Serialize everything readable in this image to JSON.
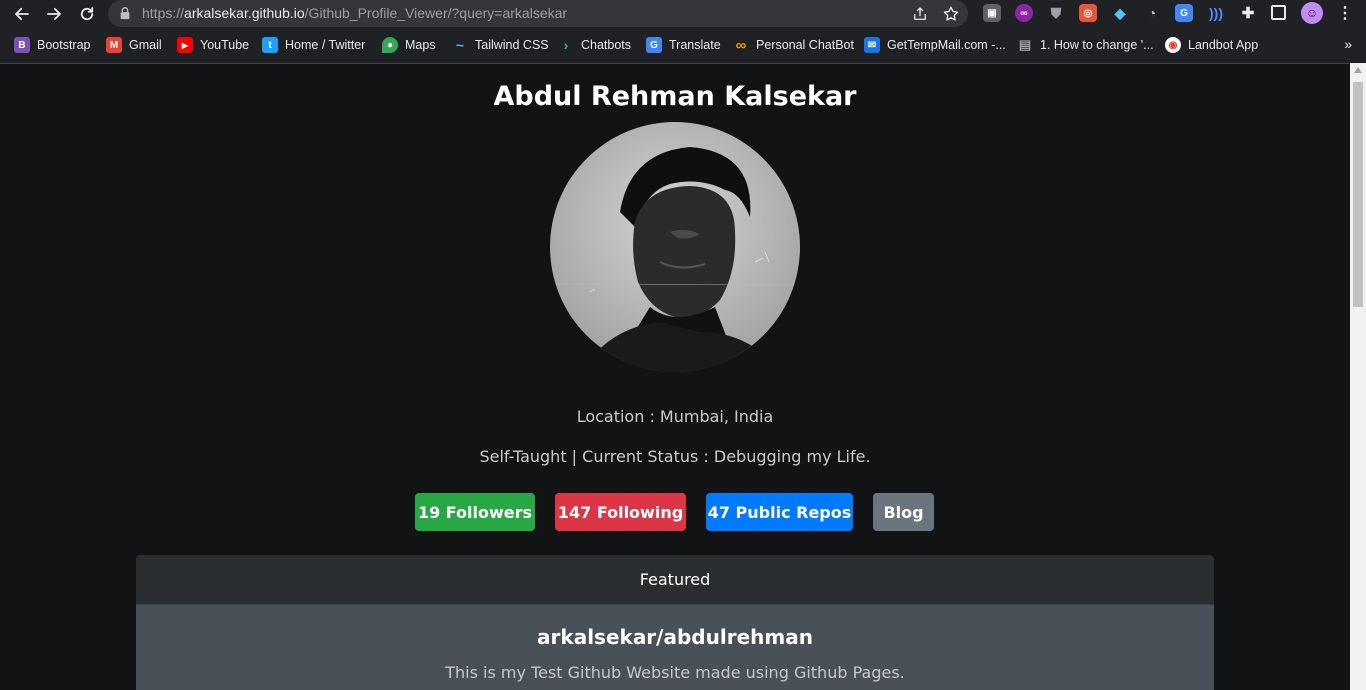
{
  "browser": {
    "url_scheme": "https://",
    "url_host": "arkalsekar.github.io",
    "url_path": "/Github_Profile_Viewer/?query=arkalsekar"
  },
  "bookmarks": [
    {
      "label": "Bootstrap",
      "icon": "bootstrap-icon",
      "color": "#7952b3",
      "glyph": "B"
    },
    {
      "label": "Gmail",
      "icon": "gmail-icon",
      "color": "#ea4335",
      "glyph": "M"
    },
    {
      "label": "YouTube",
      "icon": "youtube-icon",
      "color": "#ff0000",
      "glyph": "▶"
    },
    {
      "label": "Home / Twitter",
      "icon": "twitter-icon",
      "color": "#1da1f2",
      "glyph": "t"
    },
    {
      "label": "Maps",
      "icon": "maps-icon",
      "color": "#34a853",
      "glyph": "●"
    },
    {
      "label": "Tailwind CSS",
      "icon": "tailwind-icon",
      "color": "#38bdf8",
      "glyph": "~"
    },
    {
      "label": "Chatbots",
      "icon": "chatbots-icon",
      "color": "#1abc9c",
      "glyph": "›"
    },
    {
      "label": "Translate",
      "icon": "translate-icon",
      "color": "#4285f4",
      "glyph": "G"
    },
    {
      "label": "Personal ChatBot",
      "icon": "infinity-icon",
      "color": "#f29900",
      "glyph": "∞"
    },
    {
      "label": "GetTempMail.com -...",
      "icon": "mail-icon",
      "color": "#1a73e8",
      "glyph": "✉"
    },
    {
      "label": "1. How to change '...",
      "icon": "document-icon",
      "color": "#9aa0a6",
      "glyph": "▤"
    },
    {
      "label": "Landbot App",
      "icon": "landbot-icon",
      "color": "#ffffff",
      "glyph": "◉"
    }
  ],
  "bookmarks_more": "»",
  "profile": {
    "name": "Abdul Rehman Kalsekar",
    "location": "Location : Mumbai, India",
    "bio": "Self-Taught | Current Status : Debugging my Life.",
    "followers_label": "19 Followers",
    "following_label": "147 Following",
    "repos_label": "47 Public Repos",
    "blog_label": "Blog"
  },
  "featured": {
    "header": "Featured",
    "repo_name": "arkalsekar/abdulrehman",
    "repo_description": "This is my Test Github Website made using Github Pages."
  },
  "colors": {
    "followers": "#28a745",
    "following": "#dc3545",
    "repos": "#007bff",
    "blog": "#6c757d"
  }
}
